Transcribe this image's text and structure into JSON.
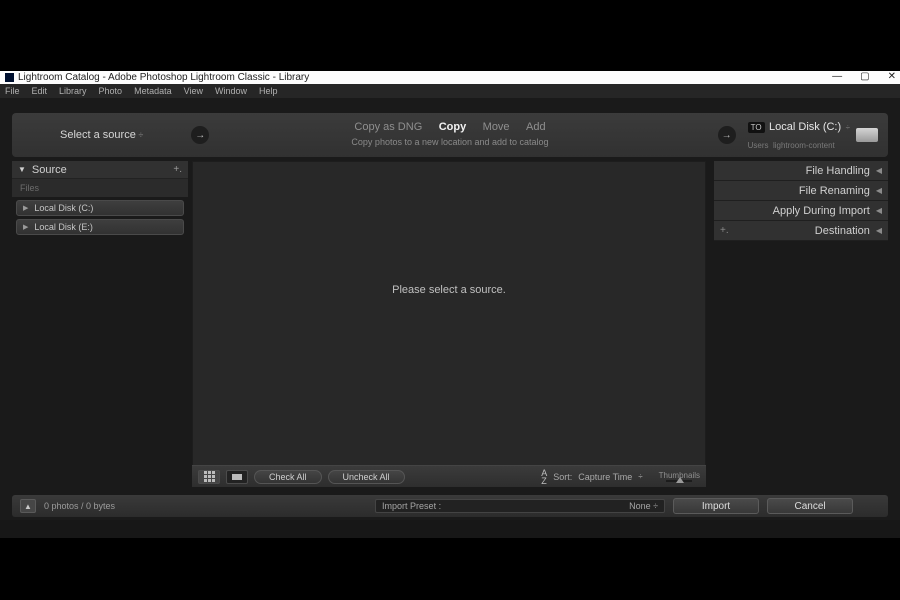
{
  "window": {
    "title": "Lightroom Catalog - Adobe Photoshop Lightroom Classic - Library",
    "controls": {
      "minimize": "—",
      "maximize": "▢",
      "close": "✕"
    }
  },
  "menu": {
    "items": [
      "File",
      "Edit",
      "Library",
      "Photo",
      "Metadata",
      "View",
      "Window",
      "Help"
    ]
  },
  "header": {
    "source_label": "Select a source",
    "actions": {
      "copy_dng": "Copy as DNG",
      "copy": "Copy",
      "move": "Move",
      "add": "Add"
    },
    "subtitle": "Copy photos to a new location and add to catalog",
    "to_badge": "TO",
    "dest_label": "Local Disk (C:)",
    "dest_sub_left": "Users",
    "dest_sub_right": "lightroom-content"
  },
  "source_panel": {
    "title": "Source",
    "files_label": "Files",
    "drives": [
      "Local Disk (C:)",
      "Local Disk (E:)"
    ]
  },
  "center": {
    "message": "Please select a source."
  },
  "center_toolbar": {
    "check_all": "Check All",
    "uncheck_all": "Uncheck All",
    "sort_label": "Sort:",
    "sort_value": "Capture Time",
    "thumb_label": "Thumbnails"
  },
  "right_panels": {
    "file_handling": "File Handling",
    "file_renaming": "File Renaming",
    "apply_during_import": "Apply During Import",
    "destination": "Destination"
  },
  "bottom": {
    "status": "0 photos / 0 bytes",
    "preset_label": "Import Preset :",
    "preset_value": "None ÷",
    "import": "Import",
    "cancel": "Cancel"
  }
}
